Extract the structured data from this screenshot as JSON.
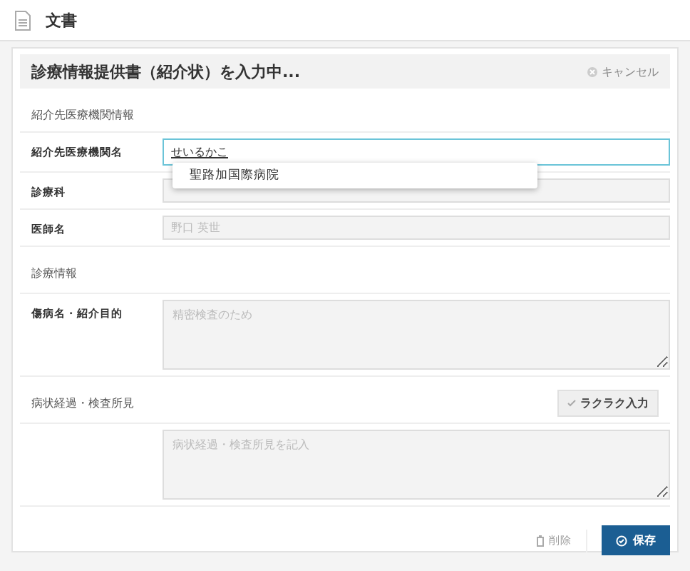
{
  "header": {
    "title": "文書"
  },
  "form": {
    "title": "診療情報提供書（紹介状）を入力中...",
    "cancel": "キャンセル",
    "sections": [
      {
        "title": "紹介先医療機関情報",
        "fields": [
          {
            "kind": "input",
            "label": "紹介先医療機関名",
            "value": "せいるかこ",
            "focused": true,
            "disabled": false,
            "suggestions": [
              "聖路加国際病院"
            ]
          },
          {
            "kind": "input",
            "label": "診療科",
            "focused": false,
            "disabled": true
          },
          {
            "kind": "input",
            "label": "医師名",
            "placeholder": "野口 英世",
            "focused": false,
            "disabled": true
          }
        ]
      },
      {
        "title": "診療情報",
        "fields": [
          {
            "kind": "textarea",
            "label": "傷病名・紹介目的",
            "placeholder": "精密検査のため",
            "focused": false,
            "disabled": true
          }
        ]
      },
      {
        "title": "病状経過・検査所見",
        "action": "ラクラク入力",
        "fields": [
          {
            "kind": "textarea",
            "placeholder": "病状経過・検査所見を記入",
            "focused": false,
            "disabled": true
          }
        ]
      }
    ],
    "delete": "削除",
    "save": "保存"
  }
}
